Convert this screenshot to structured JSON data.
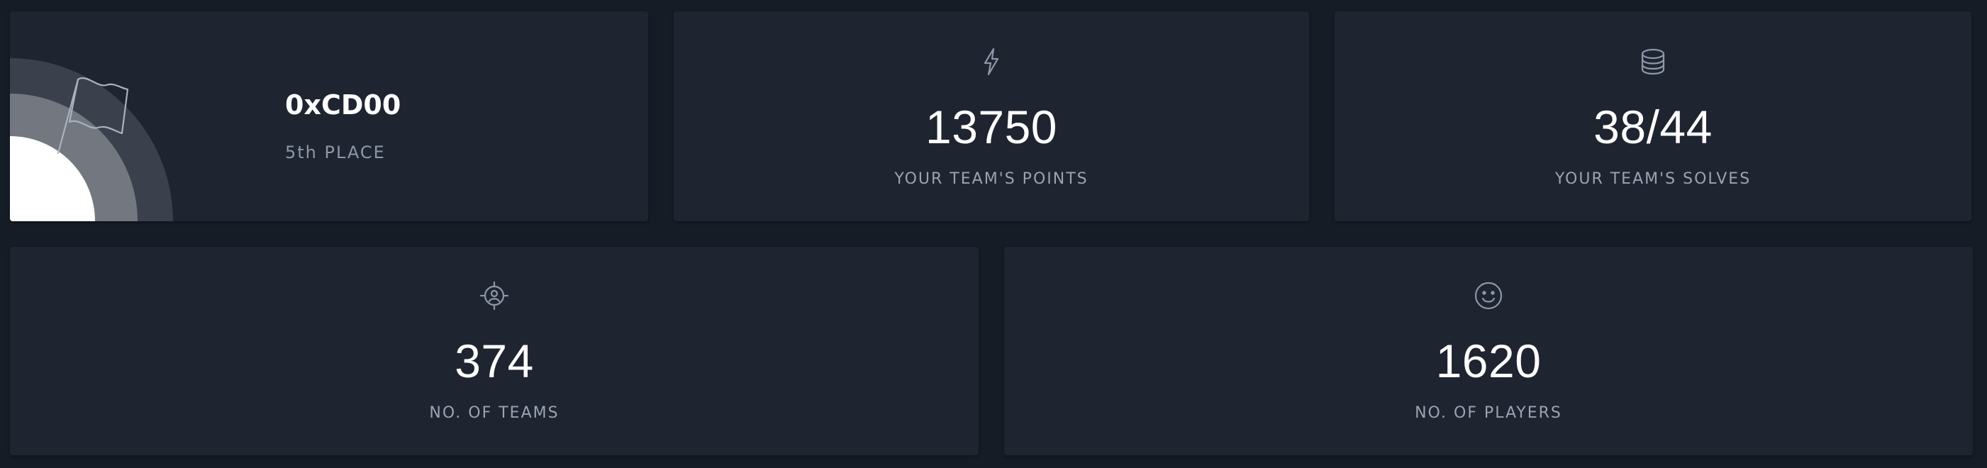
{
  "team": {
    "name": "0xCD00",
    "place": "5th PLACE"
  },
  "stats": {
    "points": {
      "value": "13750",
      "label": "YOUR TEAM'S POINTS",
      "icon": "lightning-icon"
    },
    "solves": {
      "value": "38/44",
      "label": "YOUR TEAM'S SOLVES",
      "icon": "database-icon"
    },
    "teams": {
      "value": "374",
      "label": "NO. OF TEAMS",
      "icon": "target-icon"
    },
    "players": {
      "value": "1620",
      "label": "NO. OF PLAYERS",
      "icon": "smiley-icon"
    }
  },
  "colors": {
    "background": "#161c26",
    "card": "#1e2430",
    "text_primary": "#ffffff",
    "text_muted": "#9aa4b4",
    "icon": "#8e98aa"
  }
}
